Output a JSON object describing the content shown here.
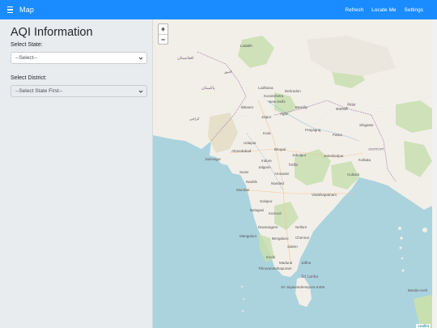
{
  "navbar": {
    "brand": "Map",
    "links": [
      "Refresh",
      "Locate Me",
      "Settings"
    ]
  },
  "sidebar": {
    "title": "AQI Information",
    "state_label": "Select State:",
    "state_value": "--Select--",
    "district_label": "Select District:",
    "district_value": "--Select State First--"
  },
  "map": {
    "zoom_in": "+",
    "zoom_out": "−",
    "attribution": "Leaflet",
    "labels": {
      "ladakh": "Ladakh",
      "ludhiana": "Ludhiana",
      "dehradun": "Dehradun",
      "kurukshetra": "Kurukshetra",
      "new_delhi": "New Delhi",
      "bikaner": "Bikaner",
      "jaipur": "Jaipur",
      "agra": "Agra",
      "kota": "Kota",
      "bareilly": "Bareilly",
      "prayagraj": "Prayagraj",
      "patna": "Patna",
      "nepal": "नेपाल",
      "udaipur": "Udaipur",
      "ahmedabad": "Ahmedabad",
      "bhopal": "Bhopal",
      "jabalpur": "Jabalpur",
      "jamshedpur": "Jamshedpur",
      "kolkata": "Kolkata",
      "bangladesh": "বাংলাদেশ",
      "surat": "Surat",
      "indore": "Indore",
      "india": "India",
      "jalgaon": "Jalgaon",
      "amravati": "Amravati",
      "nashik": "Nashik",
      "nanded": "Nanded",
      "cuttack": "Cuttack",
      "mumbai": "Mumbai",
      "visakhapatnam": "Visakhapatnam",
      "solapur": "Solapur",
      "belagavi": "Belagavi",
      "kurnool": "Kurnool",
      "nellore": "Nellore",
      "davanagere": "Davanagere",
      "mangaluru": "Mangaluru",
      "bengaluru": "Bengaluru",
      "chennai": "Chennai",
      "salem": "Salem",
      "kochi": "Kochi",
      "madurai": "Madurai",
      "jaffna": "Jaffna",
      "thiruvananthapuram": "Thiruvananthapuram",
      "sri_lanka": "Sri Lanka",
      "sri_jayawardenepura": "Sri Jayawardenepura Kotte",
      "banda_aceh": "Banda Aceh",
      "kathmandu": "काठमाडौं",
      "shigatse": "Shigatse",
      "pakistan": "پاکستان",
      "afghanistan": "افغانستان",
      "lahore": "لاہور",
      "karachi": "کراچی",
      "jamnagar": "Jamnagar"
    }
  },
  "colors": {
    "navbar": "#1a8cff",
    "sea": "#abd3de",
    "land": "#f2efe9",
    "green": "#c8dfb0"
  }
}
